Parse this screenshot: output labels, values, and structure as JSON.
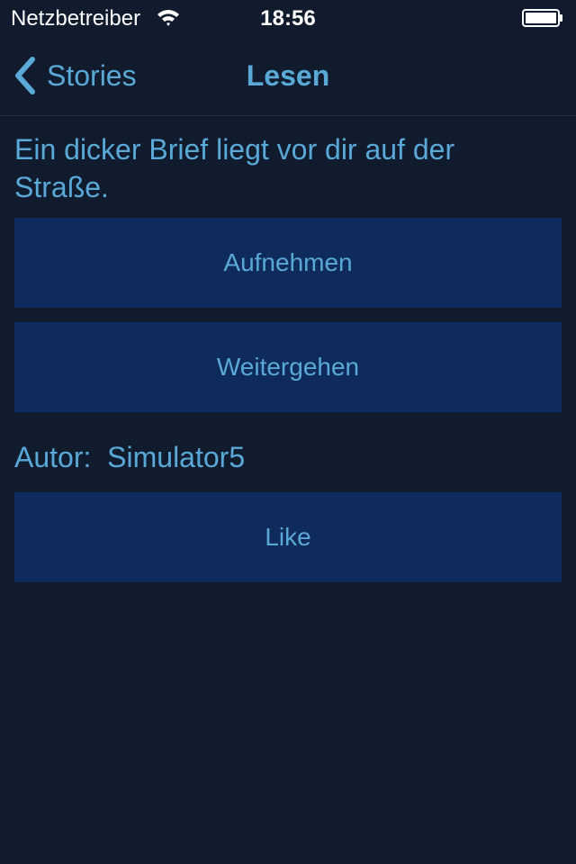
{
  "status_bar": {
    "carrier": "Netzbetreiber",
    "time": "18:56"
  },
  "nav": {
    "back_label": "Stories",
    "title": "Lesen"
  },
  "story": {
    "text": "Ein dicker Brief liegt vor dir auf der Straße."
  },
  "choices": [
    {
      "label": "Aufnehmen"
    },
    {
      "label": "Weitergehen"
    }
  ],
  "author": {
    "prefix": "Autor:",
    "name": "Simulator5"
  },
  "like_button": {
    "label": "Like"
  },
  "colors": {
    "background": "#101b2e",
    "accent": "#5aa8d6",
    "button_bg": "#0f2b5c"
  },
  "icons": [
    "wifi-icon",
    "battery-icon",
    "chevron-left-icon"
  ]
}
